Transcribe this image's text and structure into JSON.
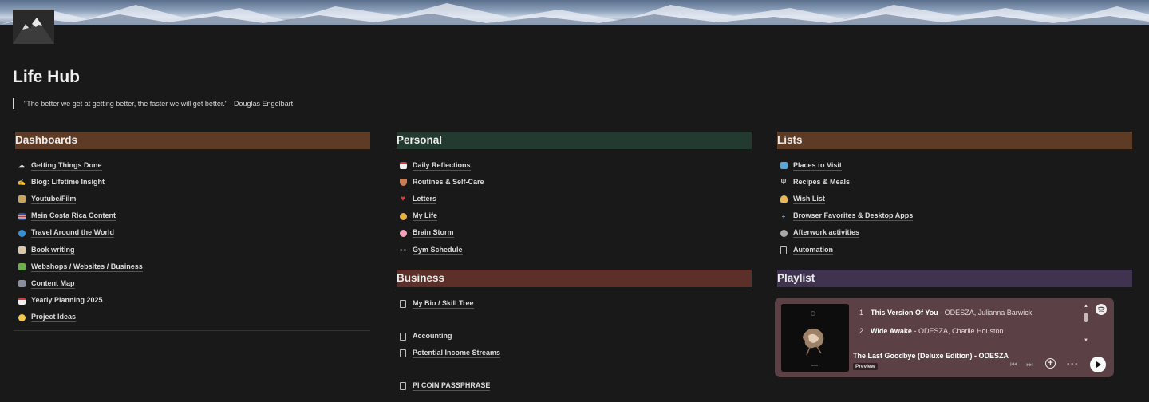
{
  "page": {
    "title": "Life Hub",
    "quote": "\"The better we get at getting better, the faster we will get better.\" - Douglas Engelbart"
  },
  "columns": {
    "dashboards": {
      "heading": "Dashboards",
      "color": "#5e3b25",
      "items": [
        {
          "label": "Getting Things Done",
          "icon": "cloud-icon"
        },
        {
          "label": "Blog: Lifetime Insight",
          "icon": "writing-hand-icon"
        },
        {
          "label": "Youtube/Film",
          "icon": "clapper-icon"
        },
        {
          "label": "Mein Costa Rica Content",
          "icon": "flag-icon"
        },
        {
          "label": "Travel Around the World",
          "icon": "globe-icon"
        },
        {
          "label": "Book writing",
          "icon": "book-icon"
        },
        {
          "label": "Webshops / Websites / Business",
          "icon": "money-icon"
        },
        {
          "label": "Content Map",
          "icon": "computer-icon"
        },
        {
          "label": "Yearly Planning 2025",
          "icon": "calendar-icon"
        },
        {
          "label": "Project Ideas",
          "icon": "lightbulb-icon"
        }
      ]
    },
    "personal": {
      "heading": "Personal",
      "color": "#233a31",
      "items": [
        {
          "label": "Daily Reflections",
          "icon": "calendar-icon"
        },
        {
          "label": "Routines & Self-Care",
          "icon": "bowl-icon"
        },
        {
          "label": "Letters",
          "icon": "heart-icon"
        },
        {
          "label": "My Life",
          "icon": "people-icon"
        },
        {
          "label": "Brain Storm",
          "icon": "brain-icon"
        },
        {
          "label": "Gym Schedule",
          "icon": "dumbbell-icon"
        }
      ]
    },
    "business": {
      "heading": "Business",
      "color": "#5c2f29",
      "items": [
        {
          "label": "My Bio / Skill Tree",
          "icon": "page-icon"
        },
        {
          "label": "Accounting",
          "icon": "page-icon"
        },
        {
          "label": "Potential Income Streams",
          "icon": "page-icon"
        },
        {
          "label": "PI COIN PASSPHRASE",
          "icon": "page-icon"
        }
      ]
    },
    "lists": {
      "heading": "Lists",
      "color": "#5e3b25",
      "items": [
        {
          "label": "Places to Visit",
          "icon": "map-icon"
        },
        {
          "label": "Recipes & Meals",
          "icon": "fork-knife-icon"
        },
        {
          "label": "Wish List",
          "icon": "pray-icon"
        },
        {
          "label": "Browser Favorites & Desktop Apps",
          "icon": "plus-icon"
        },
        {
          "label": "Afterwork activities",
          "icon": "dancer-icon"
        },
        {
          "label": "Automation",
          "icon": "page-icon"
        }
      ]
    },
    "playlist": {
      "heading": "Playlist",
      "color": "#3f3350"
    }
  },
  "player": {
    "tracks": [
      {
        "num": "1",
        "title": "This Version Of You",
        "artist": " - ODESZA, Julianna Barwick"
      },
      {
        "num": "2",
        "title": "Wide Awake",
        "artist": " - ODESZA, Charlie Houston"
      }
    ],
    "album": "The Last Goodbye (Deluxe Edition) - ODESZA",
    "preview": "Preview",
    "logo": "spotify-icon"
  }
}
